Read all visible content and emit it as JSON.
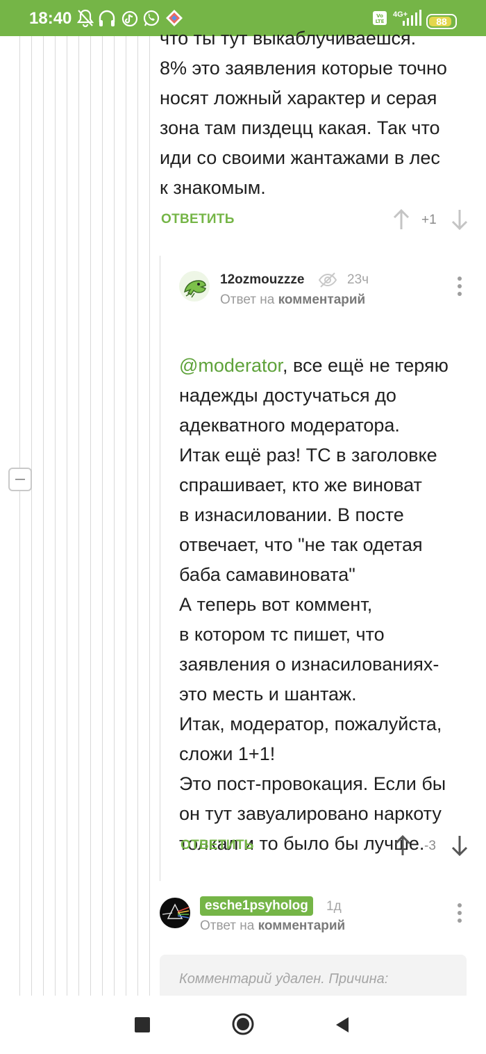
{
  "status_bar": {
    "time": "18:40",
    "network": "4G+",
    "battery": "88",
    "battery_level": 0.88,
    "icons": [
      "bell-off-icon",
      "headphones-icon",
      "tiktok-icon",
      "whatsapp-icon",
      "app-icon",
      "volte-icon",
      "signal-icon",
      "battery-icon"
    ]
  },
  "comment1": {
    "lines": "что ты тут выкаблучиваешся.\n8% это заявления которые точно\nносят ложный характер и серая\nзона там пиздецц какая. Так что\nиди со своими жантажами в лес\nк знакомым.",
    "reply_label": "ОТВЕТИТЬ",
    "score": "+1"
  },
  "comment2": {
    "username": "12ozmouzzze",
    "time": "23ч",
    "reply_to_prefix": "Ответ на",
    "reply_to_link": "комментарий",
    "mention": "@moderator",
    "text_after_mention": ", все ещё не теряю\nнадежды достучаться до\nадекватного модератора.\nИтак ещё раз! ТС в заголовке\nспрашивает, кто же виноват\nв изнасиловании. В посте\nотвечает, что \"не так одетая\nбаба самавиновата\"\nА теперь вот коммент,\nв котором тс пишет, что\nзаявления о изнасилованиях-\nэто месть и шантаж.\nИтак, модератор, пожалуйста,\nсложи 1+1!\nЭто пост-провокация. Если бы\nон тут завуалировано наркоту\nтолкал и то было бы лучше.",
    "reply_label": "ОТВЕТИТЬ",
    "score": "-3"
  },
  "comment3": {
    "username": "esche1psyholog",
    "time": "1д",
    "reply_to_prefix": "Ответ на",
    "reply_to_link": "комментарий",
    "deleted_text": "Комментарий удален. Причина:"
  },
  "colors": {
    "brand": "#75b547",
    "status_bar": "#75b547",
    "text": "#1f1f1f",
    "muted": "#9a9a9a"
  }
}
